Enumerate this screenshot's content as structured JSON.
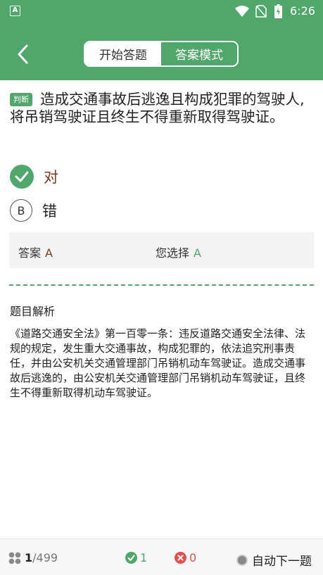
{
  "status_bar": {
    "app_icon_letter": "A",
    "time": "6:26",
    "icons": [
      "wifi-icon",
      "no-sim-icon",
      "battery-charging-icon"
    ]
  },
  "header": {
    "back_icon": "chevron-left-icon",
    "tabs": [
      {
        "label": "开始答题",
        "active": false
      },
      {
        "label": "答案模式",
        "active": true
      }
    ]
  },
  "question": {
    "type_tag": "判断",
    "text": "造成交通事故后逃逸且构成犯罪的驾驶人,将吊销驾驶证且终生不得重新取得驾驶证。"
  },
  "options": [
    {
      "letter": "A",
      "label": "对",
      "state": "selected-correct"
    },
    {
      "letter": "B",
      "label": "错",
      "state": "unselected"
    }
  ],
  "answer": {
    "answer_label": "答案",
    "answer_value": "A",
    "choice_label": "您选择",
    "choice_value": "A"
  },
  "explanation": {
    "title": "题目解析",
    "text": "《道路交通安全法》第一百零一条：违反道路交通安全法律、法规的规定，发生重大交通事故，构成犯罪的，依法追究刑事责任，并由公安机关交通管理部门吊销机动车驾驶证。造成交通事故后逃逸的，由公安机关交通管理部门吊销机动车驾驶证，且终生不得重新取得机动车驾驶证。"
  },
  "bottom_bar": {
    "current": "1",
    "total": "/499",
    "correct_count": "1",
    "wrong_count": "0",
    "auto_next_label": "自动下一题"
  },
  "colors": {
    "primary": "#51a66b",
    "answer_text": "#7a3a22",
    "wrong": "#e05050"
  }
}
